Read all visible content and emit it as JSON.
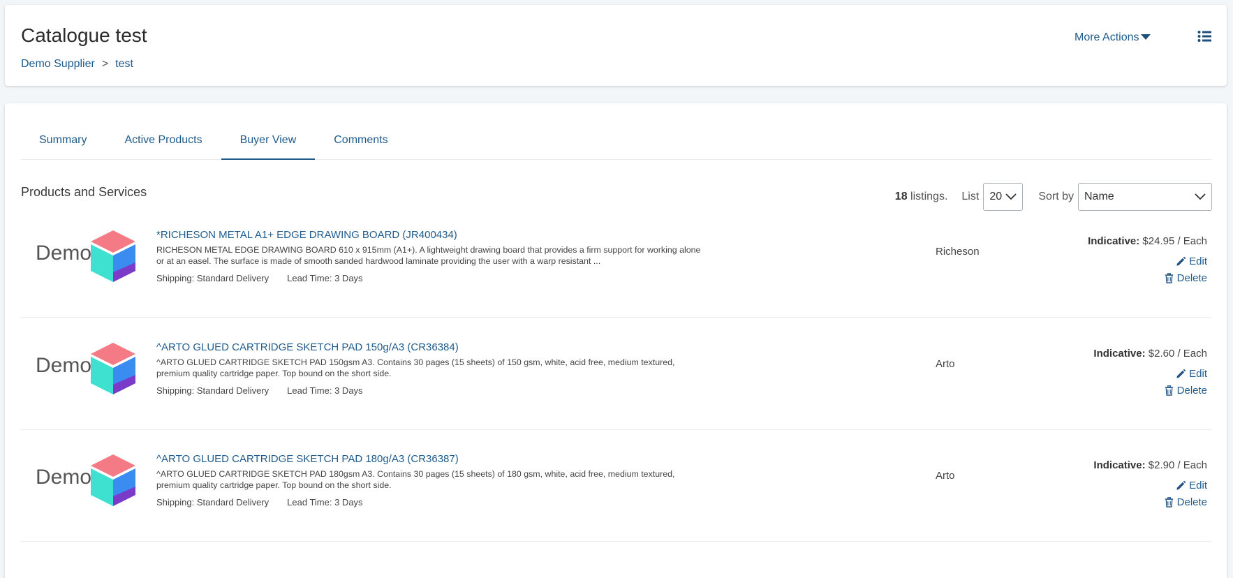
{
  "header": {
    "title": "Catalogue test",
    "breadcrumb": [
      {
        "label": "Demo Supplier"
      },
      {
        "label": "test"
      }
    ],
    "breadcrumb_separator": ">",
    "more_actions": "More Actions"
  },
  "tabs": [
    {
      "label": "Summary"
    },
    {
      "label": "Active Products"
    },
    {
      "label": "Buyer View",
      "active": true
    },
    {
      "label": "Comments"
    }
  ],
  "section_title": "Products and Services",
  "controls": {
    "listing_count": "18",
    "listing_suffix": "listings.",
    "list_label": "List",
    "list_value": "20",
    "sort_label": "Sort by",
    "sort_value": "Name"
  },
  "products": [
    {
      "logo_text": "Demo",
      "title": "*RICHESON METAL A1+ EDGE DRAWING BOARD (JR400434)",
      "description": "RICHESON METAL EDGE DRAWING BOARD 610 x 915mm (A1+). A lightweight drawing board that provides a firm support for working alone or at an easel. The surface is made of smooth sanded hardwood laminate providing the user with a warp resistant ...",
      "shipping": "Shipping: Standard Delivery",
      "lead_time": "Lead Time: 3 Days",
      "brand": "Richeson",
      "price_label": "Indicative:",
      "price": "$24.95 / Each",
      "edit_label": "Edit",
      "delete_label": "Delete"
    },
    {
      "logo_text": "Demo",
      "title": "^ARTO GLUED CARTRIDGE SKETCH PAD 150g/A3 (CR36384)",
      "description": "^ARTO GLUED CARTRIDGE SKETCH PAD 150gsm A3. Contains 30 pages (15 sheets) of 150 gsm, white, acid free, medium textured, premium quality cartridge paper. Top bound on the short side.",
      "shipping": "Shipping: Standard Delivery",
      "lead_time": "Lead Time: 3 Days",
      "brand": "Arto",
      "price_label": "Indicative:",
      "price": "$2.60 / Each",
      "edit_label": "Edit",
      "delete_label": "Delete"
    },
    {
      "logo_text": "Demo",
      "title": "^ARTO GLUED CARTRIDGE SKETCH PAD 180g/A3 (CR36387)",
      "description": "^ARTO GLUED CARTRIDGE SKETCH PAD 180gsm A3. Contains 30 pages (15 sheets) of 180 gsm, white, acid free, medium textured, premium quality cartridge paper. Top bound on the short side.",
      "shipping": "Shipping: Standard Delivery",
      "lead_time": "Lead Time: 3 Days",
      "brand": "Arto",
      "price_label": "Indicative:",
      "price": "$2.90 / Each",
      "edit_label": "Edit",
      "delete_label": "Delete"
    }
  ],
  "colors": {
    "accent": "#1f5b8c",
    "cube_top": "#f47b86",
    "cube_left": "#3ee0d0",
    "cube_right": "#3b8cf0",
    "cube_bottom": "#7a3cc8"
  }
}
